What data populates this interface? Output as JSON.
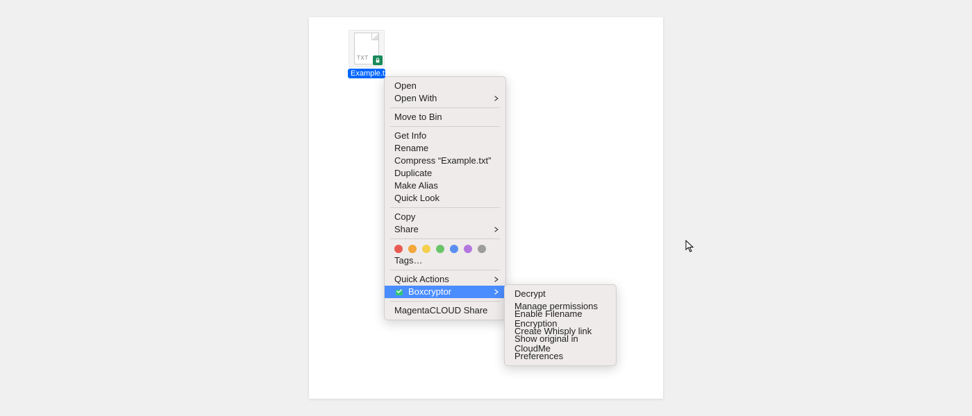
{
  "file": {
    "name": "Example.txt",
    "ext_label": "TXT",
    "badge": "lock-icon",
    "badge_color": "#1a8a5a"
  },
  "context_menu": {
    "groups": [
      [
        {
          "label": "Open",
          "submenu": false
        },
        {
          "label": "Open With",
          "submenu": true
        }
      ],
      [
        {
          "label": "Move to Bin",
          "submenu": false
        }
      ],
      [
        {
          "label": "Get Info",
          "submenu": false
        },
        {
          "label": "Rename",
          "submenu": false
        },
        {
          "label": "Compress “Example.txt”",
          "submenu": false
        },
        {
          "label": "Duplicate",
          "submenu": false
        },
        {
          "label": "Make Alias",
          "submenu": false
        },
        {
          "label": "Quick Look",
          "submenu": false
        }
      ],
      [
        {
          "label": "Copy",
          "submenu": false
        },
        {
          "label": "Share",
          "submenu": true
        }
      ]
    ],
    "tags_label": "Tags…",
    "tag_colors": [
      "#e85b52",
      "#f2a63c",
      "#f4cf4e",
      "#6ac46a",
      "#5a8ff0",
      "#b377e0",
      "#9d9d9d"
    ],
    "bottom_group": [
      {
        "label": "Quick Actions",
        "submenu": true
      },
      {
        "label": "Boxcryptor",
        "submenu": true,
        "highlighted": true,
        "icon": "boxcryptor-icon"
      }
    ],
    "last_group": [
      {
        "label": "MagentaCLOUD Share",
        "submenu": false
      }
    ]
  },
  "submenu": {
    "items": [
      "Decrypt",
      "Manage permissions",
      "Enable Filename Encryption",
      "Create Whisply link",
      "Show original in CloudMe",
      "Preferences"
    ]
  }
}
